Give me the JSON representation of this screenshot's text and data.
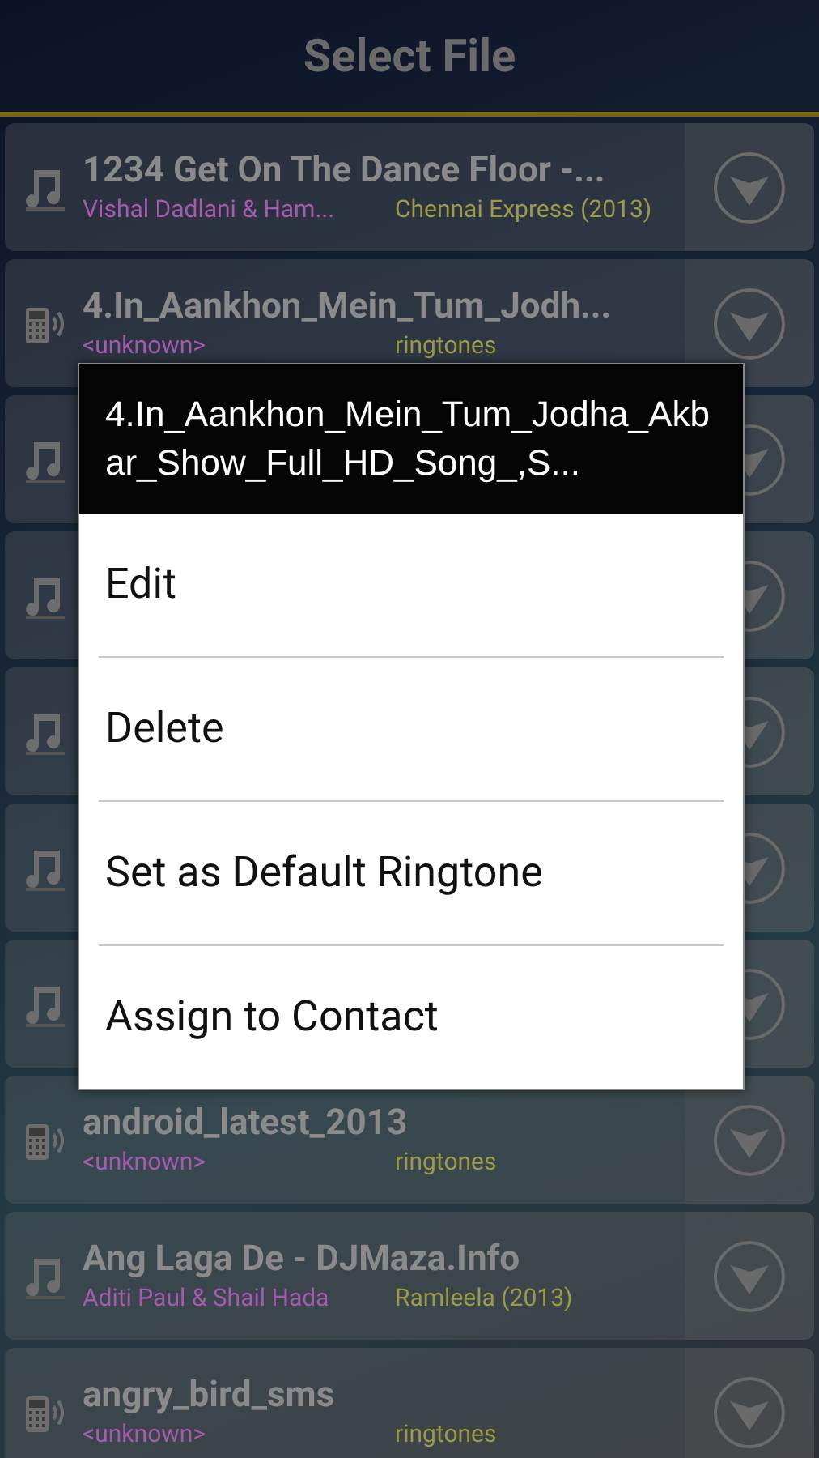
{
  "header": {
    "title": "Select File"
  },
  "rows": [
    {
      "kind": "music",
      "title": "1234 Get On The Dance Floor -...",
      "artist": "Vishal Dadlani & Ham...",
      "album": "Chennai Express (2013)"
    },
    {
      "kind": "ringtone",
      "title": "4.In_Aankhon_Mein_Tum_Jodh...",
      "artist": "<unknown>",
      "album": "ringtones"
    },
    {
      "kind": "music"
    },
    {
      "kind": "music"
    },
    {
      "kind": "music"
    },
    {
      "kind": "music"
    },
    {
      "kind": "music"
    },
    {
      "kind": "ringtone",
      "title": "android_latest_2013",
      "artist": "<unknown>",
      "album": "ringtones"
    },
    {
      "kind": "music",
      "title": "Ang Laga De - DJMaza.Info",
      "artist": "Aditi Paul & Shail Hada",
      "album": "Ramleela (2013)"
    },
    {
      "kind": "ringtone",
      "title": "angry_bird_sms",
      "artist": "<unknown>",
      "album": "ringtones"
    }
  ],
  "context_menu": {
    "title": "4.In_Aankhon_Mein_Tum_Jodha_Akbar_Show_Full_HD_Song_,S...",
    "items": [
      "Edit",
      "Delete",
      "Set as Default Ringtone",
      "Assign to Contact"
    ]
  }
}
